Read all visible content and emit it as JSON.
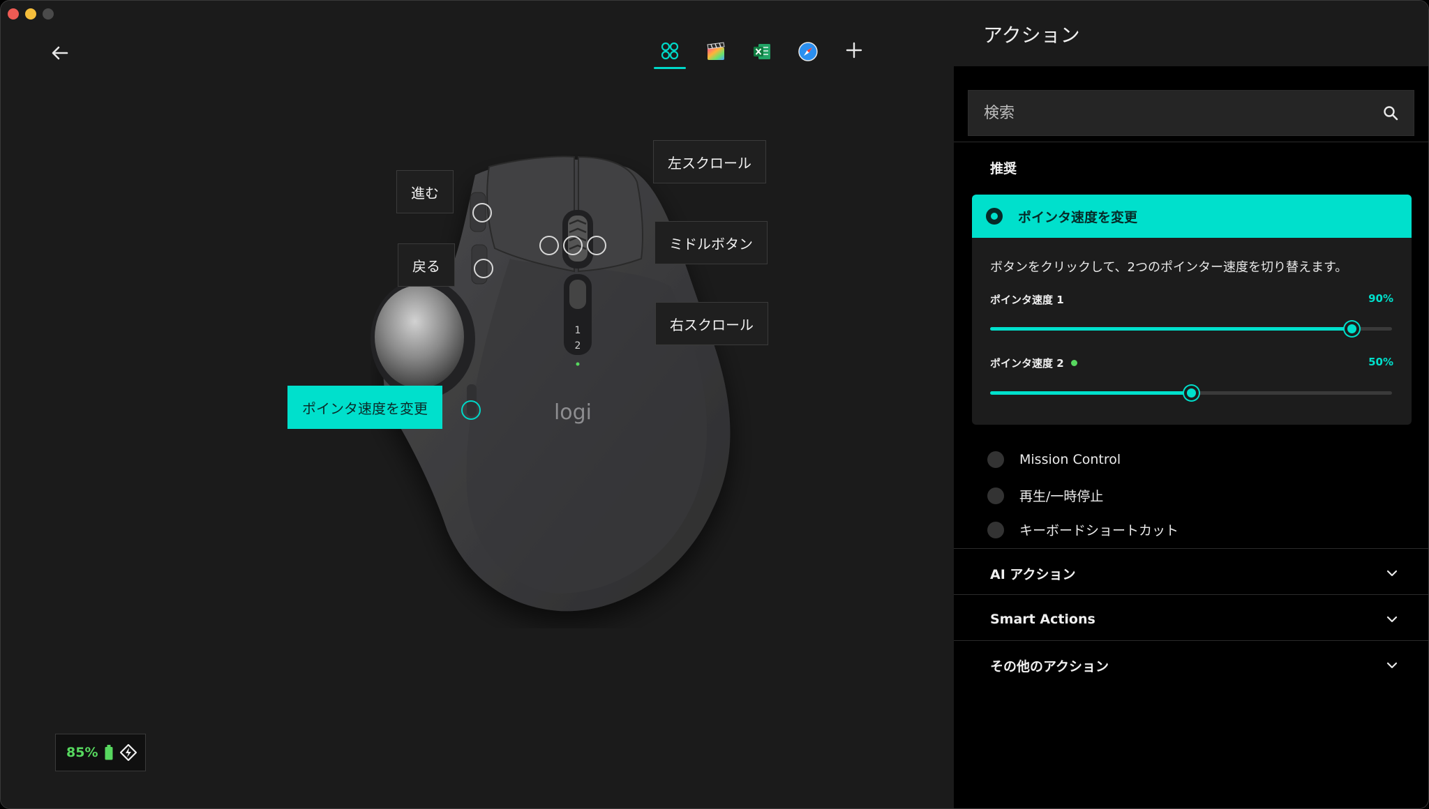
{
  "window": {
    "traffic_lights": [
      "close",
      "minimize",
      "zoom"
    ]
  },
  "toolbar": {
    "back_icon": "arrow-left-icon",
    "app_tabs": [
      {
        "name": "all-apps",
        "icon": "grid-icon",
        "active": true
      },
      {
        "name": "final-cut-pro",
        "icon": "clapper-icon",
        "active": false
      },
      {
        "name": "excel",
        "icon": "excel-icon",
        "active": false
      },
      {
        "name": "safari",
        "icon": "compass-icon",
        "active": false
      },
      {
        "name": "add",
        "icon": "plus-icon",
        "active": false
      }
    ]
  },
  "device": {
    "brand": "logi",
    "dpi_indicator": [
      "1",
      "2"
    ],
    "callouts": {
      "forward": "進む",
      "back": "戻る",
      "left_scroll": "左スクロール",
      "middle_button": "ミドルボタン",
      "right_scroll": "右スクロール",
      "pointer_speed": "ポインタ速度を変更"
    }
  },
  "battery": {
    "percent": "85%",
    "battery_icon": "battery-icon",
    "connection_icon": "logi-bolt-icon"
  },
  "panel": {
    "title": "アクション",
    "search": {
      "placeholder": "検索",
      "icon": "search-icon"
    },
    "recommended": {
      "title": "推奨",
      "selected": {
        "label": "ポインタ速度を変更",
        "description": "ボタンをクリックして、2つのポインター速度を切り替えます。",
        "sliders": [
          {
            "label": "ポインタ速度 1",
            "value_text": "90%",
            "value": 0.9,
            "indicator": false
          },
          {
            "label": "ポインタ速度 2",
            "value_text": "50%",
            "value": 0.5,
            "indicator": true
          }
        ]
      },
      "options": [
        "Mission Control",
        "再生/一時停止",
        "キーボードショートカット"
      ]
    },
    "sections": [
      {
        "label": "AI アクション"
      },
      {
        "label": "Smart Actions"
      },
      {
        "label": "その他のアクション"
      }
    ]
  },
  "colors": {
    "accent": "#00e0cc",
    "battery_green": "#57d85f",
    "panel_bg": "#000000",
    "main_bg": "#1b1b1b"
  }
}
